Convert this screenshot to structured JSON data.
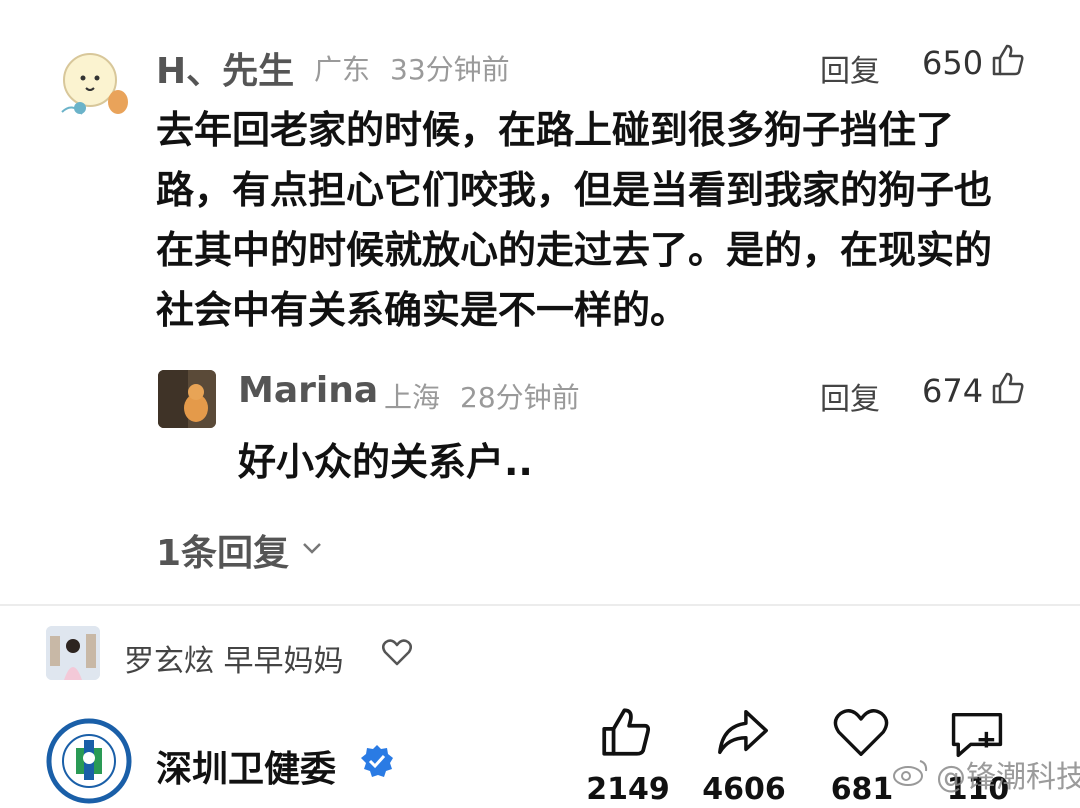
{
  "comment": {
    "author": "H、先生",
    "location": "广东",
    "time": "33分钟前",
    "reply_label": "回复",
    "likes": "650",
    "text": "去年回老家的时候，在路上碰到很多狗子挡住了路，有点担心它们咬我，但是当看到我家的狗子也在其中的时候就放心的走过去了。是的，在现实的社会中有关系确实是不一样的。"
  },
  "reply": {
    "author": "Marina",
    "location": "上海",
    "time": "28分钟前",
    "reply_label": "回复",
    "likes": "674",
    "text": "好小众的关系户.."
  },
  "more_replies": "1条回复",
  "liker": {
    "names": "罗玄炫  早早妈妈"
  },
  "post_footer": {
    "account_name": "深圳卫健委",
    "verified": true,
    "actions": [
      {
        "icon": "thumb-up-icon",
        "count": "2149"
      },
      {
        "icon": "share-icon",
        "count": "4606"
      },
      {
        "icon": "heart-icon",
        "count": "681"
      },
      {
        "icon": "comment-icon",
        "count": "110"
      }
    ]
  },
  "watermark": "@锋潮科技"
}
